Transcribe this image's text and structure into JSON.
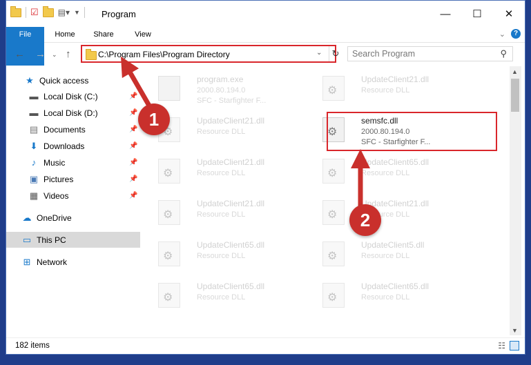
{
  "window": {
    "title": "Program",
    "controls": {
      "minimize": "—",
      "maximize": "☐",
      "close": "✕"
    }
  },
  "ribbon": {
    "tabs": [
      "File",
      "Home",
      "Share",
      "View"
    ]
  },
  "address": {
    "path": "C:\\Program Files\\Program Directory"
  },
  "search": {
    "placeholder": "Search Program"
  },
  "sidebar": {
    "items": [
      {
        "label": "Quick access",
        "icon": "star-icon"
      },
      {
        "label": "Local Disk (C:)",
        "icon": "disk-icon"
      },
      {
        "label": "Local Disk (D:)",
        "icon": "disk-icon"
      },
      {
        "label": "Documents",
        "icon": "documents-icon"
      },
      {
        "label": "Downloads",
        "icon": "download-icon"
      },
      {
        "label": "Music",
        "icon": "music-icon"
      },
      {
        "label": "Pictures",
        "icon": "pictures-icon"
      },
      {
        "label": "Videos",
        "icon": "videos-icon"
      },
      {
        "label": "OneDrive",
        "icon": "cloud-icon"
      },
      {
        "label": "This PC",
        "icon": "pc-icon"
      },
      {
        "label": "Network",
        "icon": "network-icon"
      }
    ]
  },
  "files": [
    {
      "name": "program.exe",
      "line1": "2000.80.194.0",
      "line2": "SFC - Starfighter F..."
    },
    {
      "name": "UpdateClient21.dll",
      "line1": "Resource DLL",
      "line2": ""
    },
    {
      "name": "UpdateClient21.dll",
      "line1": "Resource DLL",
      "line2": ""
    },
    {
      "name": "semsfc.dll",
      "line1": "2000.80.194.0",
      "line2": "SFC - Starfighter F..."
    },
    {
      "name": "UpdateClient21.dll",
      "line1": "Resource DLL",
      "line2": ""
    },
    {
      "name": "UpdateClient65.dll",
      "line1": "Resource DLL",
      "line2": ""
    },
    {
      "name": "UpdateClient21.dll",
      "line1": "Resource DLL",
      "line2": ""
    },
    {
      "name": "UpdateClient21.dll",
      "line1": "Resource DLL",
      "line2": ""
    },
    {
      "name": "UpdateClient65.dll",
      "line1": "Resource DLL",
      "line2": ""
    },
    {
      "name": "UpdateClient5.dll",
      "line1": "Resource DLL",
      "line2": ""
    },
    {
      "name": "UpdateClient65.dll",
      "line1": "Resource DLL",
      "line2": ""
    },
    {
      "name": "UpdateClient65.dll",
      "line1": "Resource DLL",
      "line2": ""
    }
  ],
  "status": {
    "items": "182 items"
  },
  "badges": {
    "one": "1",
    "two": "2"
  },
  "colors": {
    "accent": "#1979ca",
    "highlight": "#d9262b",
    "badge": "#c9302c"
  }
}
